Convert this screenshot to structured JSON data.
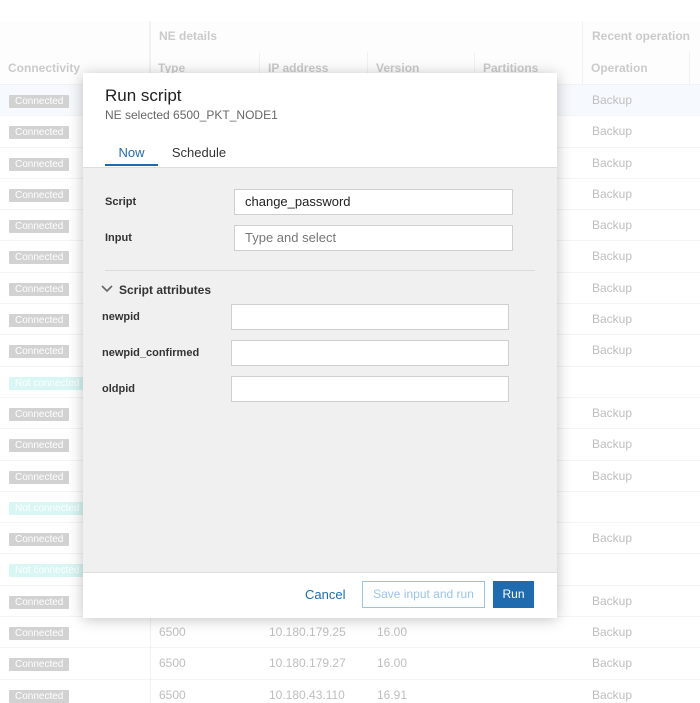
{
  "table": {
    "groups": [
      "NE details",
      "Recent operation"
    ],
    "columns": [
      "Connectivity",
      "Type",
      "IP address",
      "Version",
      "Partitions",
      "Operation"
    ],
    "rows": [
      {
        "status": "Connected",
        "type": "",
        "ip": "",
        "version": "",
        "operation": "Backup",
        "nc": false
      },
      {
        "status": "Connected",
        "type": "",
        "ip": "",
        "version": "",
        "operation": "Backup",
        "nc": false
      },
      {
        "status": "Connected",
        "type": "",
        "ip": "",
        "version": "",
        "operation": "Backup",
        "nc": false
      },
      {
        "status": "Connected",
        "type": "",
        "ip": "",
        "version": "",
        "operation": "Backup",
        "nc": false
      },
      {
        "status": "Connected",
        "type": "",
        "ip": "",
        "version": "",
        "operation": "Backup",
        "nc": false
      },
      {
        "status": "Connected",
        "type": "",
        "ip": "",
        "version": "",
        "operation": "Backup",
        "nc": false
      },
      {
        "status": "Connected",
        "type": "",
        "ip": "",
        "version": "",
        "operation": "Backup",
        "nc": false
      },
      {
        "status": "Connected",
        "type": "",
        "ip": "",
        "version": "",
        "operation": "Backup",
        "nc": false
      },
      {
        "status": "Connected",
        "type": "",
        "ip": "",
        "version": "",
        "operation": "Backup",
        "nc": false
      },
      {
        "status": "Not connected",
        "type": "",
        "ip": "",
        "version": "",
        "operation": "",
        "nc": true
      },
      {
        "status": "Connected",
        "type": "",
        "ip": "",
        "version": "",
        "operation": "Backup",
        "nc": false
      },
      {
        "status": "Connected",
        "type": "",
        "ip": "",
        "version": "",
        "operation": "Backup",
        "nc": false
      },
      {
        "status": "Connected",
        "type": "",
        "ip": "",
        "version": "",
        "operation": "Backup",
        "nc": false
      },
      {
        "status": "Not connected",
        "type": "",
        "ip": "",
        "version": "",
        "operation": "",
        "nc": true
      },
      {
        "status": "Connected",
        "type": "",
        "ip": "",
        "version": "",
        "operation": "Backup",
        "nc": false
      },
      {
        "status": "Not connected",
        "type": "",
        "ip": "",
        "version": "",
        "operation": "",
        "nc": true
      },
      {
        "status": "Connected",
        "type": "",
        "ip": "",
        "version": "",
        "operation": "Backup",
        "nc": false
      },
      {
        "status": "Connected",
        "type": "6500",
        "ip": "10.180.179.25",
        "version": "16.00",
        "operation": "Backup",
        "nc": false
      },
      {
        "status": "Connected",
        "type": "6500",
        "ip": "10.180.179.27",
        "version": "16.00",
        "operation": "Backup",
        "nc": false
      },
      {
        "status": "Connected",
        "type": "6500",
        "ip": "10.180.43.110",
        "version": "16.91",
        "operation": "Backup",
        "nc": false
      }
    ]
  },
  "dialog": {
    "title": "Run script",
    "subtitle": "NE selected 6500_PKT_NODE1",
    "tabs": [
      "Now",
      "Schedule"
    ],
    "script_label": "Script",
    "script_value": "change_password",
    "input_label": "Input",
    "input_placeholder": "Type and select",
    "section_title": "Script attributes",
    "attributes": [
      {
        "label": "newpid",
        "value": ""
      },
      {
        "label": "newpid_confirmed",
        "value": ""
      },
      {
        "label": "oldpid",
        "value": ""
      }
    ],
    "buttons": {
      "cancel": "Cancel",
      "save_run": "Save input and run",
      "run": "Run"
    }
  },
  "colors": {
    "accent": "#1f6bb0",
    "connected_badge": "#8a8a8a",
    "not_connected_badge": "#9be8e4"
  }
}
